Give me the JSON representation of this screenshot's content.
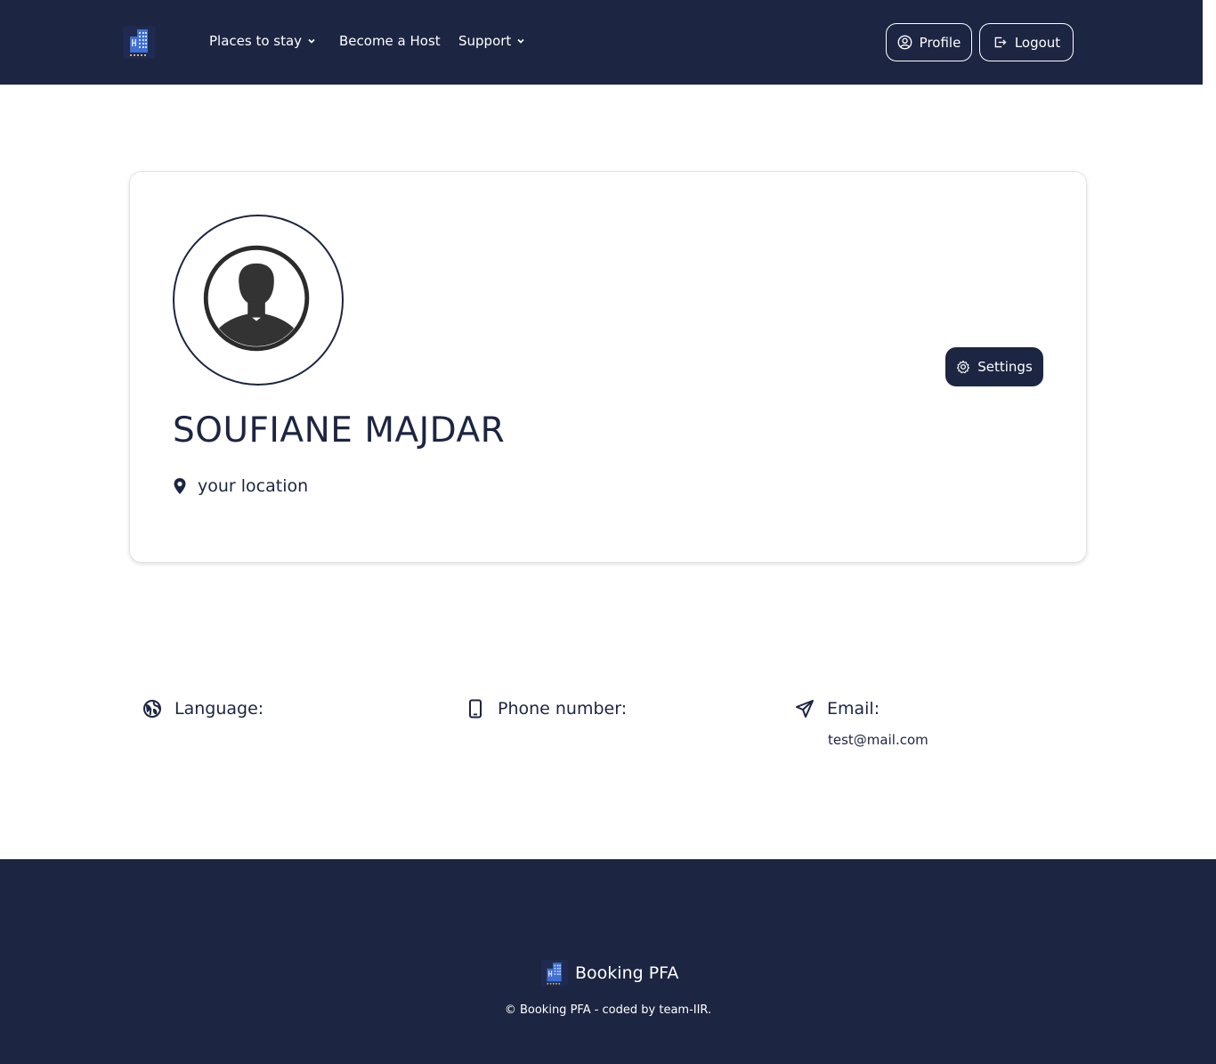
{
  "nav": {
    "links": [
      {
        "label": "Places to stay",
        "dropdown": true
      },
      {
        "label": "Become a Host",
        "dropdown": false
      },
      {
        "label": "Support",
        "dropdown": true
      }
    ],
    "profile_label": "Profile",
    "logout_label": "Logout"
  },
  "profile": {
    "name": "SOUFIANE MAJDAR",
    "location": "your location",
    "settings_label": "Settings"
  },
  "info": {
    "language_label": "Language:",
    "phone_label": "Phone number:",
    "email_label": "Email:",
    "email_value": "test@mail.com"
  },
  "footer": {
    "brand": "Booking PFA",
    "copyright": "© Booking PFA - coded by team-IIR."
  },
  "colors": {
    "primary": "#1c2541",
    "background": "#ffffff",
    "card_border": "#e3e3e3"
  },
  "icons": [
    "hotel-logo-icon",
    "chevron-down-icon",
    "user-circle-icon",
    "logout-icon",
    "gear-icon",
    "map-pin-icon",
    "globe-icon",
    "phone-icon",
    "paper-plane-icon",
    "avatar-silhouette-icon"
  ]
}
